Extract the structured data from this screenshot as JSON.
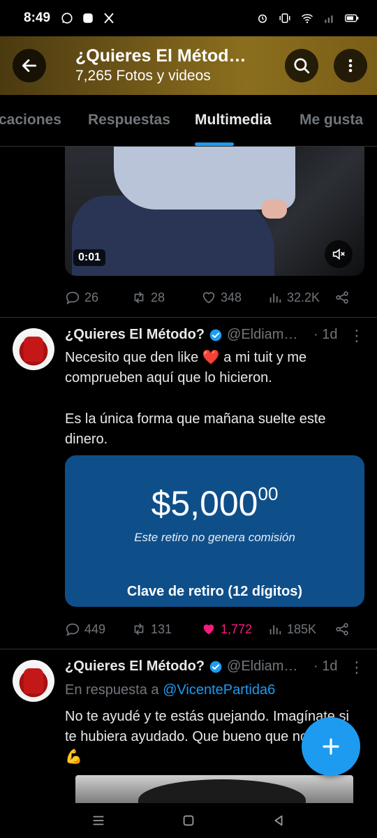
{
  "status_bar": {
    "time": "8:49"
  },
  "header": {
    "title": "¿Quieres El Métod…",
    "subtitle": "7,265 Fotos y videos"
  },
  "tabs": [
    {
      "label": "caciones",
      "active": false
    },
    {
      "label": "Respuestas",
      "active": false
    },
    {
      "label": "Multimedia",
      "active": true
    },
    {
      "label": "Me gusta",
      "active": false
    }
  ],
  "video": {
    "duration": "0:01"
  },
  "tweet0_actions": {
    "replies": "26",
    "retweets": "28",
    "likes": "348",
    "views": "32.2K"
  },
  "tweet1": {
    "name": "¿Quieres El Método?",
    "handle": "@Eldiam…",
    "time": "· 1d",
    "text_line1": "Necesito que den like",
    "heart_emoji": "❤️",
    "text_line1b": "a mi tuit y me comprueben aquí que lo hicieron.",
    "text_para2": "Es la única forma que mañana suelte este dinero.",
    "card": {
      "amount": "$5,000",
      "cents": "00",
      "note": "Este retiro no genera comisión",
      "key_label": "Clave de retiro (12 dígitos)"
    },
    "actions": {
      "replies": "449",
      "retweets": "131",
      "likes": "1,772",
      "views": "185K"
    }
  },
  "tweet2": {
    "name": "¿Quieres El Método?",
    "handle": "@Eldiam…",
    "time": "· 1d",
    "reply_prefix": "En respuesta a",
    "reply_handle": "@VicentePartida6",
    "text": "No te ayudé y te estás quejando. Imagínate si te hubiera ayudado. Que bueno que no lo hice",
    "emoji": "💪"
  },
  "colors": {
    "accent": "#1d9bf0",
    "like_pink": "#f91880",
    "muted": "#71767b",
    "bank_blue": "#0e4f8a"
  }
}
